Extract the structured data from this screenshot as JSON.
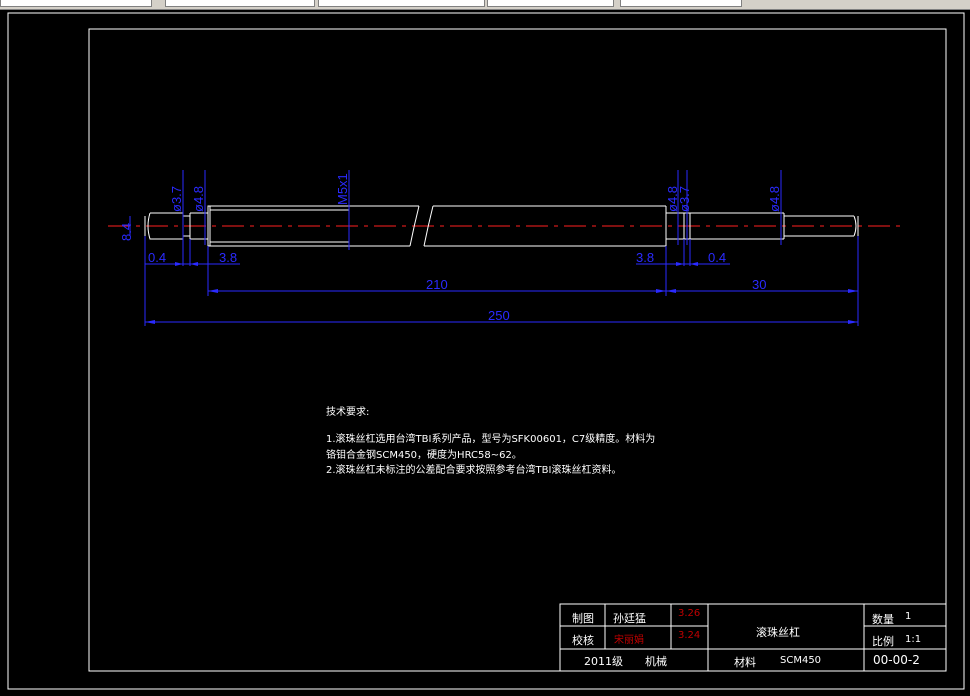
{
  "dimensions": {
    "d_left_end": "8.4",
    "d_3_7_left": "ø3.7",
    "d_4_8_left": "ø4.8",
    "thread": "M5x1",
    "d_4_8_right": "ø4.8",
    "d_3_7_right": "ø3.7",
    "d_4_8_end": "ø4.8",
    "len_0_4_left": "0.4",
    "len_3_8_left": "3.8",
    "len_3_8_right": "3.8",
    "len_0_4_right": "0.4",
    "len_210": "210",
    "len_30": "30",
    "len_250": "250"
  },
  "tech_requirements": {
    "title": "技术要求:",
    "line1": "1.滚珠丝杠选用台湾TBI系列产品，型号为SFK00601，C7级精度。材料为",
    "line2": "铬钼合金钢SCM450，硬度为HRC58~62。",
    "line3": "2.滚珠丝杠未标注的公差配合要求按照参考台湾TBI滚珠丝杠资料。"
  },
  "title_block": {
    "drawn_label": "制图",
    "drawn_name": "孙廷猛",
    "drawn_date": "3.26",
    "check_label": "校核",
    "check_name": "宋丽娟",
    "check_date": "3.24",
    "class": "2011级",
    "major": "机械",
    "part_name": "滚珠丝杠",
    "material_label": "材料",
    "material_value": "SCM450",
    "qty_label": "数量",
    "qty_value": "1",
    "scale_label": "比例",
    "scale_value": "1:1",
    "drawing_no": "00-00-2"
  },
  "colors": {
    "background": "#000000",
    "geometry": "#ffffff",
    "dimension": "#2a2aff",
    "centerline": "#ff2020",
    "title_red": "#c00000"
  }
}
